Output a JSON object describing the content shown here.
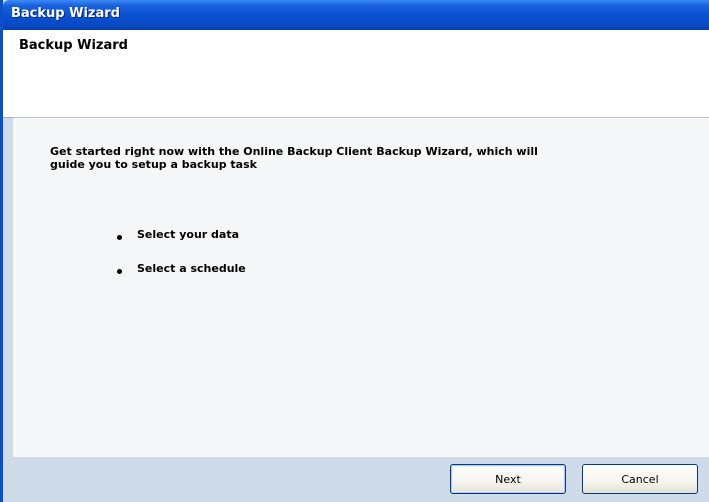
{
  "window": {
    "title": "Backup Wizard"
  },
  "header": {
    "title": "Backup Wizard"
  },
  "content": {
    "intro": "Get started right now with the Online Backup Client Backup Wizard, which will guide you to setup a backup task",
    "bullets": [
      "Select your data",
      "Select a schedule"
    ]
  },
  "footer": {
    "next_label": "Next",
    "cancel_label": "Cancel"
  },
  "colors": {
    "titlebar": "#0a52d4",
    "footer": "#cfdbe8",
    "content_bg": "#f4f6f8"
  }
}
